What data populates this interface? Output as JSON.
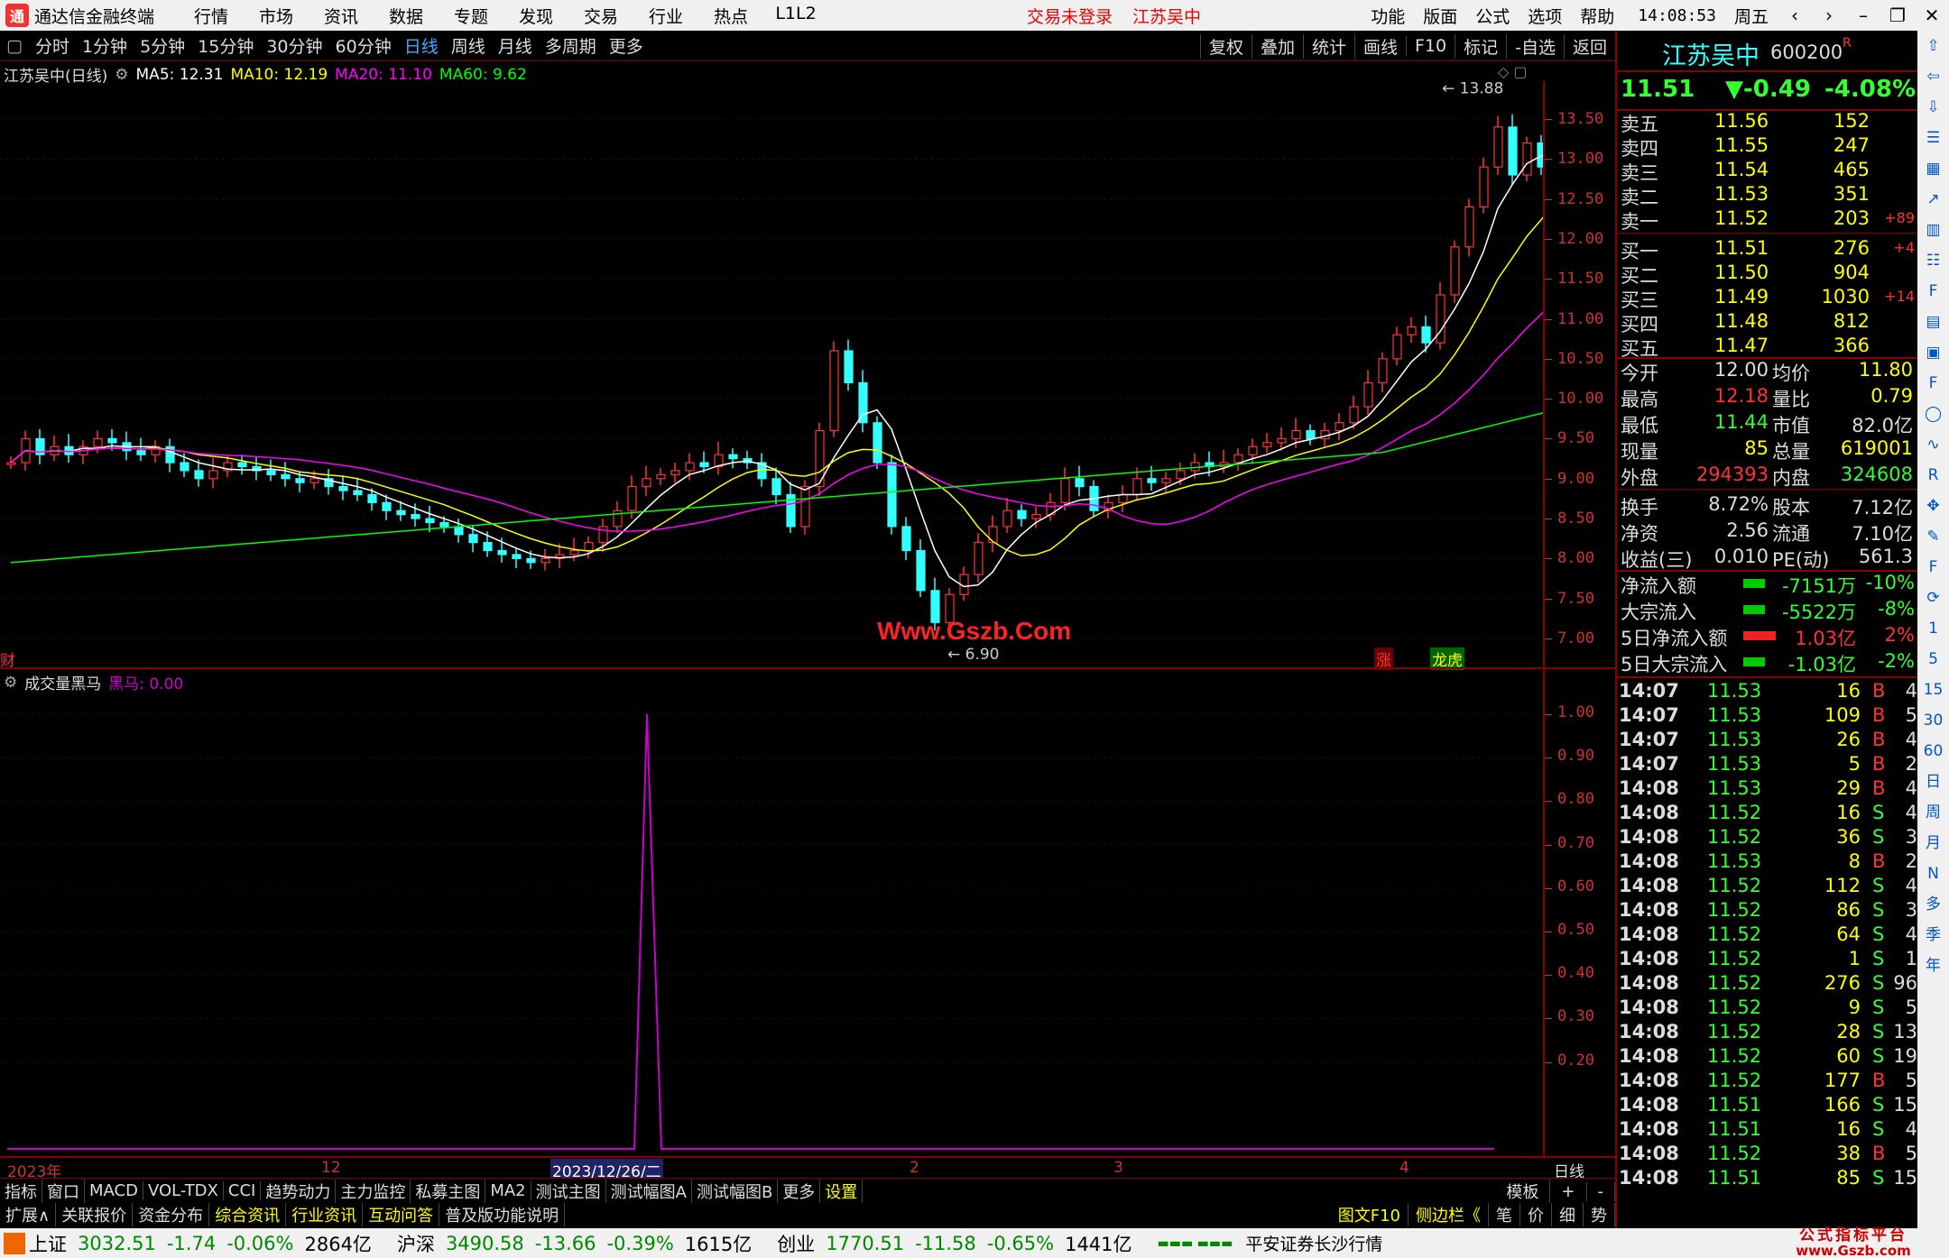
{
  "app": {
    "title": "通达信金融终端",
    "menu": [
      "行情",
      "市场",
      "资讯",
      "数据",
      "专题",
      "发现",
      "交易",
      "行业",
      "热点",
      "L1L2"
    ],
    "status_login": "交易未登录",
    "status_stock": "江苏吴中",
    "right_menu": [
      "功能",
      "版面",
      "公式",
      "选项",
      "帮助"
    ],
    "time": "14:08:53",
    "weekday": "周五"
  },
  "toolbar": {
    "periods": [
      "分时",
      "1分钟",
      "5分钟",
      "15分钟",
      "30分钟",
      "60分钟",
      "日线",
      "周线",
      "月线",
      "多周期",
      "更多"
    ],
    "active_period": "日线",
    "actions": [
      "复权",
      "叠加",
      "统计",
      "画线",
      "F10",
      "标记",
      "-自选",
      "返回"
    ]
  },
  "main_chart": {
    "name": "江苏吴中(日线)",
    "ma": [
      {
        "label": "MA5: 12.31",
        "color": "#ffffff"
      },
      {
        "label": "MA10: 12.19",
        "color": "#ffff00"
      },
      {
        "label": "MA20: 11.10",
        "color": "#ff00ff"
      },
      {
        "label": "MA60: 9.62",
        "color": "#00ff00"
      }
    ],
    "price_axis": [
      "13.50",
      "13.00",
      "12.50",
      "12.00",
      "11.50",
      "11.00",
      "10.50",
      "10.00",
      "9.50",
      "9.00",
      "8.50",
      "8.00",
      "7.50",
      "7.00"
    ],
    "high_label": "13.88",
    "low_label": "6.90",
    "watermark": "Www.Gszb.Com",
    "badge_zhang": "涨",
    "badge_longhu": "龙虎",
    "badge_cai": "财"
  },
  "indicator": {
    "name": "成交量黑马",
    "value_label": "黑马: 0.00",
    "axis": [
      "1.00",
      "0.90",
      "0.80",
      "0.70",
      "0.60",
      "0.50",
      "0.40",
      "0.30",
      "0.20"
    ]
  },
  "date_axis": {
    "labels": [
      "2023年",
      "12",
      "2023/12/26/二",
      "2",
      "3",
      "4"
    ],
    "period_tag": "日线"
  },
  "quote": {
    "name": "江苏吴中",
    "code": "600200",
    "flag": "R",
    "price": "11.51",
    "change": "▼-0.49",
    "pct": "-4.08%",
    "asks": [
      {
        "label": "卖五",
        "price": "11.56",
        "vol": "152",
        "delta": ""
      },
      {
        "label": "卖四",
        "price": "11.55",
        "vol": "247",
        "delta": ""
      },
      {
        "label": "卖三",
        "price": "11.54",
        "vol": "465",
        "delta": ""
      },
      {
        "label": "卖二",
        "price": "11.53",
        "vol": "351",
        "delta": ""
      },
      {
        "label": "卖一",
        "price": "11.52",
        "vol": "203",
        "delta": "+89"
      }
    ],
    "bids": [
      {
        "label": "买一",
        "price": "11.51",
        "vol": "276",
        "delta": "+4"
      },
      {
        "label": "买二",
        "price": "11.50",
        "vol": "904",
        "delta": ""
      },
      {
        "label": "买三",
        "price": "11.49",
        "vol": "1030",
        "delta": "+14"
      },
      {
        "label": "买四",
        "price": "11.48",
        "vol": "812",
        "delta": ""
      },
      {
        "label": "买五",
        "price": "11.47",
        "vol": "366",
        "delta": ""
      }
    ],
    "stats": [
      {
        "l1": "今开",
        "v1": "12.00",
        "c1": "#ddd",
        "l2": "均价",
        "v2": "11.80",
        "c2": "#ff0"
      },
      {
        "l1": "最高",
        "v1": "12.18",
        "c1": "#f33",
        "l2": "量比",
        "v2": "0.79",
        "c2": "#ff0"
      },
      {
        "l1": "最低",
        "v1": "11.44",
        "c1": "#3f3",
        "l2": "市值",
        "v2": "82.0亿",
        "c2": "#ddd"
      },
      {
        "l1": "现量",
        "v1": "85",
        "c1": "#ff0",
        "l2": "总量",
        "v2": "619001",
        "c2": "#ff0"
      },
      {
        "l1": "外盘",
        "v1": "294393",
        "c1": "#f33",
        "l2": "内盘",
        "v2": "324608",
        "c2": "#3f3"
      },
      {
        "l1": "换手",
        "v1": "8.72%",
        "c1": "#ddd",
        "l2": "股本",
        "v2": "7.12亿",
        "c2": "#ddd"
      },
      {
        "l1": "净资",
        "v1": "2.56",
        "c1": "#ddd",
        "l2": "流通",
        "v2": "7.10亿",
        "c2": "#ddd"
      },
      {
        "l1": "收益(三)",
        "v1": "0.010",
        "c1": "#ddd",
        "l2": "PE(动)",
        "v2": "561.3",
        "c2": "#ddd"
      }
    ],
    "flows": [
      {
        "label": "净流入额",
        "value": "-7151万",
        "pct": "-10%",
        "bar": "#0c0",
        "color": "#3f3"
      },
      {
        "label": "大宗流入",
        "value": "-5522万",
        "pct": "-8%",
        "bar": "#0c0",
        "color": "#3f3"
      },
      {
        "label": "5日净流入额",
        "value": "1.03亿",
        "pct": "2%",
        "bar": "#e22",
        "color": "#f33"
      },
      {
        "label": "5日大宗流入",
        "value": "-1.03亿",
        "pct": "-2%",
        "bar": "#0c0",
        "color": "#3f3"
      }
    ],
    "ticks": [
      {
        "t": "14:07",
        "p": "11.53",
        "v": "16",
        "d": "B",
        "n": "4"
      },
      {
        "t": "14:07",
        "p": "11.53",
        "v": "109",
        "d": "B",
        "n": "5"
      },
      {
        "t": "14:07",
        "p": "11.53",
        "v": "26",
        "d": "B",
        "n": "4"
      },
      {
        "t": "14:07",
        "p": "11.53",
        "v": "5",
        "d": "B",
        "n": "2"
      },
      {
        "t": "14:08",
        "p": "11.53",
        "v": "29",
        "d": "B",
        "n": "4"
      },
      {
        "t": "14:08",
        "p": "11.52",
        "v": "16",
        "d": "S",
        "n": "4"
      },
      {
        "t": "14:08",
        "p": "11.52",
        "v": "36",
        "d": "S",
        "n": "3"
      },
      {
        "t": "14:08",
        "p": "11.53",
        "v": "8",
        "d": "B",
        "n": "2"
      },
      {
        "t": "14:08",
        "p": "11.52",
        "v": "112",
        "d": "S",
        "n": "4"
      },
      {
        "t": "14:08",
        "p": "11.52",
        "v": "86",
        "d": "S",
        "n": "3"
      },
      {
        "t": "14:08",
        "p": "11.52",
        "v": "64",
        "d": "S",
        "n": "4"
      },
      {
        "t": "14:08",
        "p": "11.52",
        "v": "1",
        "d": "S",
        "n": "1"
      },
      {
        "t": "14:08",
        "p": "11.52",
        "v": "276",
        "d": "S",
        "n": "96"
      },
      {
        "t": "14:08",
        "p": "11.52",
        "v": "9",
        "d": "S",
        "n": "5"
      },
      {
        "t": "14:08",
        "p": "11.52",
        "v": "28",
        "d": "S",
        "n": "13"
      },
      {
        "t": "14:08",
        "p": "11.52",
        "v": "60",
        "d": "S",
        "n": "19"
      },
      {
        "t": "14:08",
        "p": "11.52",
        "v": "177",
        "d": "B",
        "n": "5"
      },
      {
        "t": "14:08",
        "p": "11.51",
        "v": "166",
        "d": "S",
        "n": "15"
      },
      {
        "t": "14:08",
        "p": "11.51",
        "v": "16",
        "d": "S",
        "n": "4"
      },
      {
        "t": "14:08",
        "p": "11.52",
        "v": "38",
        "d": "B",
        "n": "5"
      },
      {
        "t": "14:08",
        "p": "11.51",
        "v": "85",
        "d": "S",
        "n": "15"
      }
    ]
  },
  "sidebar_icons": [
    "up-arrow-icon",
    "left-arrow-icon",
    "down-arrow-icon",
    "list-icon",
    "table-icon",
    "chart-icon",
    "bar-chart-icon",
    "news-icon",
    "f10-icon",
    "grid-icon",
    "doc-icon",
    "f2-icon",
    "circle-icon",
    "line-icon",
    "rsi-icon",
    "move-icon",
    "pen-icon",
    "fs-icon",
    "refresh-icon"
  ],
  "sidebar_text": [
    "1",
    "5",
    "15",
    "30",
    "60",
    "日",
    "周",
    "月",
    "N",
    "多",
    "季",
    "年"
  ],
  "tabs1": [
    "指标",
    "窗口",
    "MACD",
    "VOL-TDX",
    "CCI",
    "趋势动力",
    "主力监控",
    "私募主图",
    "MA2",
    "测试主图",
    "测试幅图A",
    "测试幅图B",
    "更多",
    "设置"
  ],
  "tabs1_active": "设置",
  "tabs1_right": [
    "模板",
    "+",
    "-"
  ],
  "tabs2": [
    "扩展∧",
    "关联报价",
    "资金分布",
    "综合资讯",
    "行业资讯",
    "互动问答",
    "普及版功能说明"
  ],
  "tabs2_right": [
    "图文F10",
    "侧边栏《",
    "笔",
    "价",
    "细",
    "势"
  ],
  "statusbar": {
    "sh": {
      "name": "上证",
      "value": "3032.51",
      "chg": "-1.74",
      "pct": "-0.06%",
      "amt": "2864亿"
    },
    "sz": {
      "name": "沪深",
      "value": "3490.58",
      "chg": "-13.66",
      "pct": "-0.39%",
      "amt": "1615亿"
    },
    "cy": {
      "name": "创业",
      "value": "1770.51",
      "chg": "-11.58",
      "pct": "-0.65%",
      "amt": "1441亿"
    },
    "broker": "平安证券长沙行情",
    "brand_top": "公式指标平台",
    "brand_bottom": "www.Gszb.com"
  }
}
